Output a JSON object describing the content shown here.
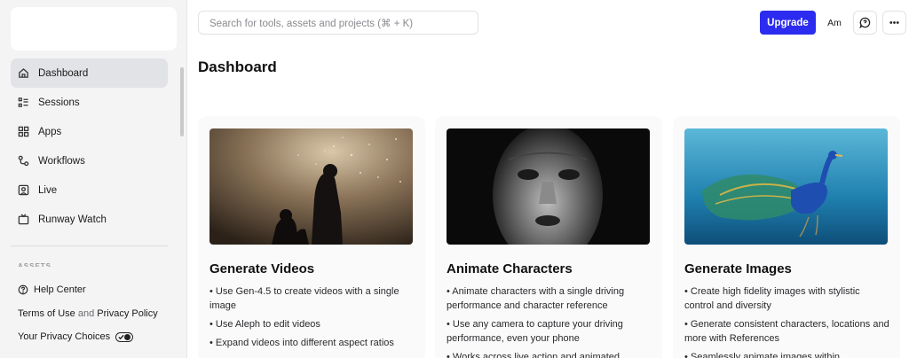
{
  "sidebar": {
    "nav": [
      {
        "label": "Dashboard",
        "icon": "home-icon",
        "active": true
      },
      {
        "label": "Sessions",
        "icon": "list-icon",
        "active": false
      },
      {
        "label": "Apps",
        "icon": "grid-icon",
        "active": false
      },
      {
        "label": "Workflows",
        "icon": "workflow-icon",
        "active": false
      },
      {
        "label": "Live",
        "icon": "live-icon",
        "active": false
      },
      {
        "label": "Runway Watch",
        "icon": "tv-icon",
        "active": false
      }
    ],
    "section_assets": "ASSETS",
    "help_center": "Help Center",
    "terms": "Terms of Use",
    "and": "and",
    "privacy_policy": "Privacy Policy",
    "privacy_choices": "Your Privacy Choices"
  },
  "topbar": {
    "search_placeholder": "Search for tools, assets and projects (⌘ + K)",
    "upgrade": "Upgrade",
    "avatar": "Am"
  },
  "main": {
    "title": "Dashboard",
    "cards": [
      {
        "title": "Generate Videos",
        "bullets": [
          "• Use Gen-4.5 to create videos with a single image",
          "• Use Aleph to edit videos",
          "• Expand videos into different aspect ratios"
        ]
      },
      {
        "title": "Animate Characters",
        "bullets": [
          "• Animate characters with a single driving performance and character reference",
          "• Use any camera to capture your driving performance, even your phone",
          "• Works across live action and animated"
        ]
      },
      {
        "title": "Generate Images",
        "bullets": [
          "• Create high fidelity images with stylistic control and diversity",
          "• Generate consistent characters, locations and more with References",
          "• Seamlessly animate images within"
        ]
      }
    ]
  },
  "colors": {
    "accent": "#2c2cf0",
    "sidebar_bg": "#f4f4f5",
    "active_nav": "#e2e3e6"
  }
}
